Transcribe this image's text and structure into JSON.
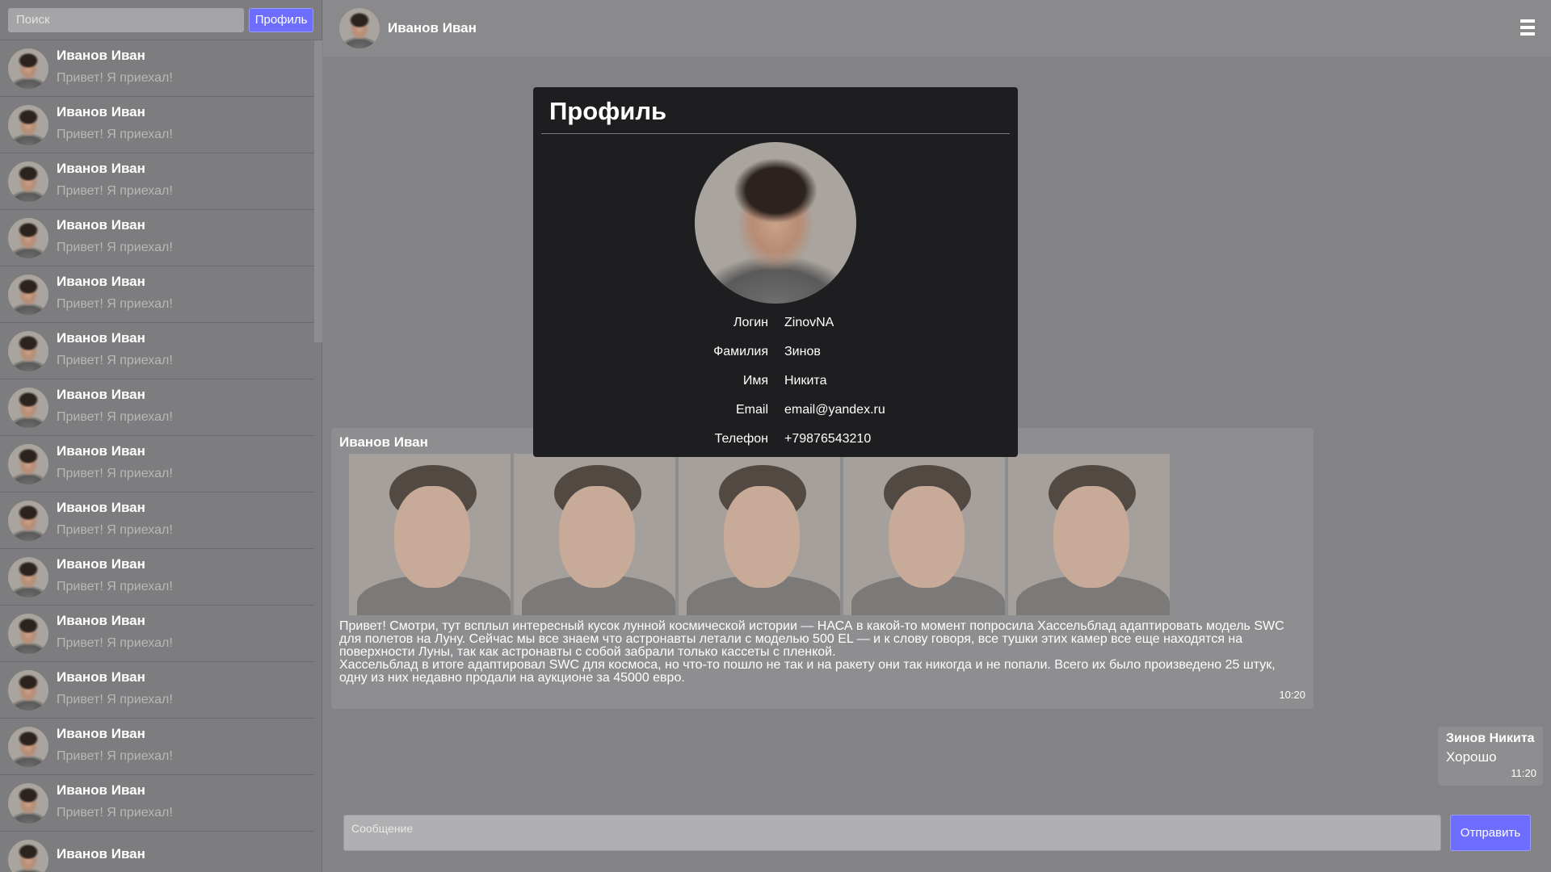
{
  "sidebar": {
    "search_placeholder": "Поиск",
    "profile_button": "Профиль",
    "chats": [
      {
        "name": "Иванов Иван",
        "last": "Привет! Я приехал!"
      },
      {
        "name": "Иванов Иван",
        "last": "Привет! Я приехал!"
      },
      {
        "name": "Иванов Иван",
        "last": "Привет! Я приехал!"
      },
      {
        "name": "Иванов Иван",
        "last": "Привет! Я приехал!"
      },
      {
        "name": "Иванов Иван",
        "last": "Привет! Я приехал!"
      },
      {
        "name": "Иванов Иван",
        "last": "Привет! Я приехал!"
      },
      {
        "name": "Иванов Иван",
        "last": "Привет! Я приехал!"
      },
      {
        "name": "Иванов Иван",
        "last": "Привет! Я приехал!"
      },
      {
        "name": "Иванов Иван",
        "last": "Привет! Я приехал!"
      },
      {
        "name": "Иванов Иван",
        "last": "Привет! Я приехал!"
      },
      {
        "name": "Иванов Иван",
        "last": "Привет! Я приехал!"
      },
      {
        "name": "Иванов Иван",
        "last": "Привет! Я приехал!"
      },
      {
        "name": "Иванов Иван",
        "last": "Привет! Я приехал!"
      },
      {
        "name": "Иванов Иван",
        "last": "Привет! Я приехал!"
      },
      {
        "name": "Иванов Иван",
        "last": ""
      }
    ]
  },
  "header": {
    "name": "Иванов Иван",
    "menu_icon": "hamburger-menu-icon"
  },
  "messages": [
    {
      "author": "Иванов Иван",
      "photo_count": 5,
      "text": "Привет! Смотри, тут всплыл интересный кусок лунной космической истории — НАСА в какой-то момент попросила Хассельблад адаптировать модель SWC\nдля полетов на Луну. Сейчас мы все знаем что астронавты летали с моделью 500 EL — и к слову говоря, все тушки этих камер все еще находятся на\nповерхности Луны, так как астронавты с собой забрали только кассеты с пленкой.\nХассельблад в итоге адаптировал SWC для космоса, но что-то пошло не так и на ракету они так никогда и не попали. Всего их было произведено 25 штук,\nодну из них недавно продали на аукционе за 45000 евро.",
      "time": "10:20"
    },
    {
      "author": "Зинов Никита",
      "text": "Хорошо",
      "time": "11:20"
    }
  ],
  "composer": {
    "placeholder": "Сообщение",
    "send_button": "Отправить"
  },
  "profile_modal": {
    "title": "Профиль",
    "fields": [
      {
        "label": "Логин",
        "value": "ZinovNA"
      },
      {
        "label": "Фамилия",
        "value": "Зинов"
      },
      {
        "label": "Имя",
        "value": "Никита"
      },
      {
        "label": "Email",
        "value": "email@yandex.ru"
      },
      {
        "label": "Телефон",
        "value": "+79876543210"
      }
    ]
  },
  "colors": {
    "accent": "#6d6dff",
    "modal_bg": "#1e1e21",
    "page_bg": "#838385"
  }
}
